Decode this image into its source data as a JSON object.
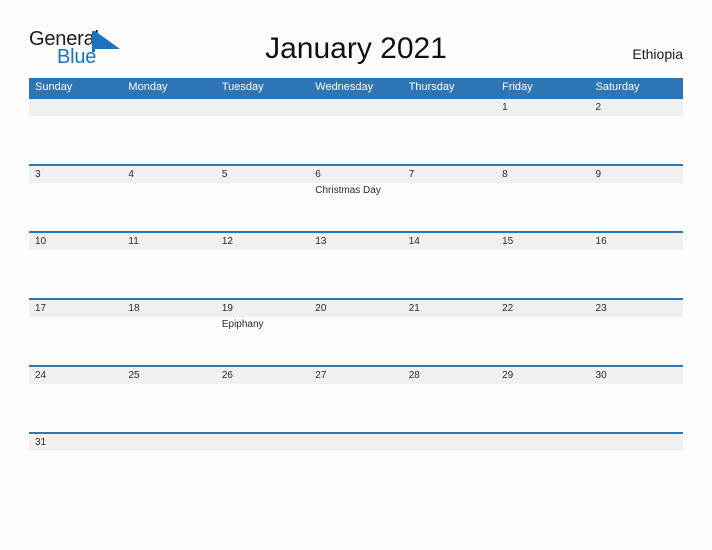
{
  "brand": {
    "name_part1": "General",
    "name_part2": "Blue",
    "mark": "blue-triangle-flag",
    "color_dark": "#1a1a1a",
    "color_blue": "#1b74bb"
  },
  "header": {
    "title": "January 2021",
    "country": "Ethiopia"
  },
  "theme": {
    "header_blue": "#2e75b6",
    "row_divider_blue": "#2e75b6",
    "number_band_gray": "#f0f0f0",
    "page_background": "#fdfdfd",
    "text_dark": "#2a2a2a"
  },
  "calendar": {
    "month": "January",
    "year": "2021",
    "weekday_headers": [
      "Sunday",
      "Monday",
      "Tuesday",
      "Wednesday",
      "Thursday",
      "Friday",
      "Saturday"
    ],
    "weeks": [
      {
        "days": [
          {
            "number": "",
            "event": ""
          },
          {
            "number": "",
            "event": ""
          },
          {
            "number": "",
            "event": ""
          },
          {
            "number": "",
            "event": ""
          },
          {
            "number": "",
            "event": ""
          },
          {
            "number": "1",
            "event": ""
          },
          {
            "number": "2",
            "event": ""
          }
        ]
      },
      {
        "days": [
          {
            "number": "3",
            "event": ""
          },
          {
            "number": "4",
            "event": ""
          },
          {
            "number": "5",
            "event": ""
          },
          {
            "number": "6",
            "event": "Christmas Day"
          },
          {
            "number": "7",
            "event": ""
          },
          {
            "number": "8",
            "event": ""
          },
          {
            "number": "9",
            "event": ""
          }
        ]
      },
      {
        "days": [
          {
            "number": "10",
            "event": ""
          },
          {
            "number": "11",
            "event": ""
          },
          {
            "number": "12",
            "event": ""
          },
          {
            "number": "13",
            "event": ""
          },
          {
            "number": "14",
            "event": ""
          },
          {
            "number": "15",
            "event": ""
          },
          {
            "number": "16",
            "event": ""
          }
        ]
      },
      {
        "days": [
          {
            "number": "17",
            "event": ""
          },
          {
            "number": "18",
            "event": ""
          },
          {
            "number": "19",
            "event": "Epiphany"
          },
          {
            "number": "20",
            "event": ""
          },
          {
            "number": "21",
            "event": ""
          },
          {
            "number": "22",
            "event": ""
          },
          {
            "number": "23",
            "event": ""
          }
        ]
      },
      {
        "days": [
          {
            "number": "24",
            "event": ""
          },
          {
            "number": "25",
            "event": ""
          },
          {
            "number": "26",
            "event": ""
          },
          {
            "number": "27",
            "event": ""
          },
          {
            "number": "28",
            "event": ""
          },
          {
            "number": "29",
            "event": ""
          },
          {
            "number": "30",
            "event": ""
          }
        ]
      },
      {
        "short": true,
        "days": [
          {
            "number": "31",
            "event": ""
          },
          {
            "number": "",
            "event": ""
          },
          {
            "number": "",
            "event": ""
          },
          {
            "number": "",
            "event": ""
          },
          {
            "number": "",
            "event": ""
          },
          {
            "number": "",
            "event": ""
          },
          {
            "number": "",
            "event": ""
          }
        ]
      }
    ]
  }
}
